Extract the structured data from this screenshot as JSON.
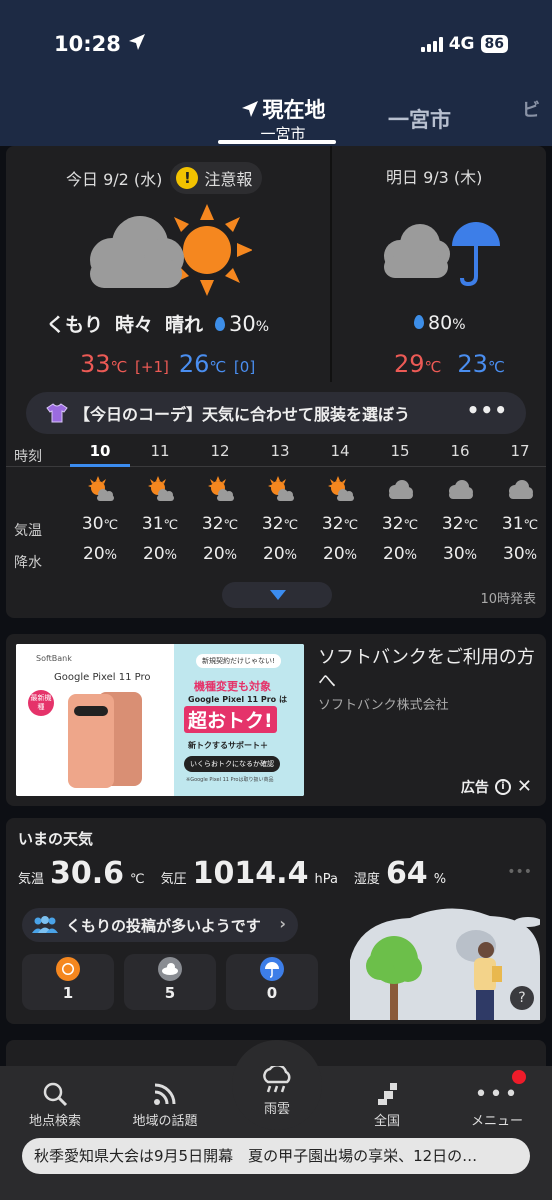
{
  "status": {
    "time": "10:28",
    "network": "4G",
    "battery": "86"
  },
  "header": {
    "current_tab": {
      "title": "現在地",
      "subtitle": "一宮市"
    },
    "tab2": "一宮市",
    "tab3": "ビ"
  },
  "forecast": {
    "today": {
      "date": "今日 9/2 (水)",
      "warning": "注意報",
      "condition": [
        "くもり",
        "時々",
        "晴れ"
      ],
      "pop": "30",
      "pop_unit": "%",
      "high": "33",
      "high_diff": "[+1]",
      "low": "26",
      "low_diff": "[0]",
      "temp_unit": "℃"
    },
    "tomorrow": {
      "date": "明日 9/3 (木)",
      "pop": "80",
      "pop_unit": "%",
      "high": "29",
      "low": "23",
      "temp_unit": "℃"
    },
    "coordinate_banner": "【今日のコーデ】天気に合わせて服装を選ぼう",
    "hourly_labels": {
      "time": "時刻",
      "temp": "気温",
      "precip": "降水"
    },
    "hourly": [
      {
        "hour": "10",
        "icon": "sun-cloud-icon",
        "temp": "30",
        "precip": "20"
      },
      {
        "hour": "11",
        "icon": "sun-cloud-icon",
        "temp": "31",
        "precip": "20"
      },
      {
        "hour": "12",
        "icon": "sun-cloud-icon",
        "temp": "32",
        "precip": "20"
      },
      {
        "hour": "13",
        "icon": "sun-cloud-icon",
        "temp": "32",
        "precip": "20"
      },
      {
        "hour": "14",
        "icon": "sun-cloud-icon",
        "temp": "32",
        "precip": "20"
      },
      {
        "hour": "15",
        "icon": "cloud-icon",
        "temp": "32",
        "precip": "20"
      },
      {
        "hour": "16",
        "icon": "cloud-icon",
        "temp": "32",
        "precip": "30"
      },
      {
        "hour": "17",
        "icon": "cloud-icon",
        "temp": "31",
        "precip": "30"
      }
    ],
    "issued": "10時発表"
  },
  "ad": {
    "title": "ソフトバンクをご利用の方へ",
    "sponsor": "ソフトバンク株式会社",
    "label": "広告",
    "creative": {
      "brand": "SoftBank",
      "model": "Google Pixel 11 Pro",
      "new_badge": "最新機種",
      "tag": "新規契約だけじゃない!",
      "line1": "機種変更も対象",
      "line2": "Google Pixel 11 Pro は",
      "line3": "超おトク!",
      "line4": "新トクするサポート＋",
      "line5": "いくらおトクになるか確認",
      "line6": "※Google Pixel 11 Proは取り扱い商品"
    }
  },
  "current": {
    "title": "いまの天気",
    "temp_label": "気温",
    "temp": "30.6",
    "temp_unit": "℃",
    "pressure_label": "気圧",
    "pressure": "1014.4",
    "pressure_unit": "hPa",
    "humidity_label": "湿度",
    "humidity": "64",
    "humidity_unit": "%",
    "posts_text": "くもりの投稿が多いようです",
    "post_counts": [
      {
        "icon": "sun-icon",
        "count": "1"
      },
      {
        "icon": "cloud-icon",
        "count": "5"
      },
      {
        "icon": "umbrella-icon",
        "count": "0"
      }
    ],
    "help": "?"
  },
  "nav": {
    "search": "地点検索",
    "topics": "地域の話題",
    "rain": "雨雲",
    "national": "全国",
    "menu": "メニュー"
  },
  "ticker": "秋季愛知県大会は9月5日開幕　夏の甲子園出場の享栄、12日の…",
  "colors": {
    "header": "#1d2a44",
    "accent": "#3b8cf0",
    "hot": "#ec5a55",
    "cold": "#4a8ef0",
    "sun": "#f5871f"
  }
}
